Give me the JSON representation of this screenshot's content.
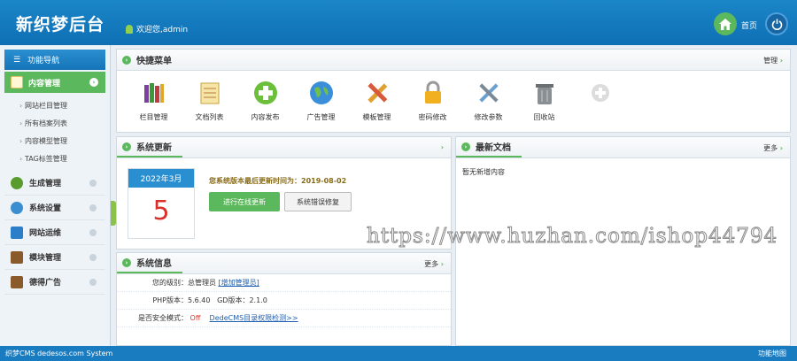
{
  "header": {
    "logo": "新织梦后台",
    "welcome": "欢迎您,admin",
    "home_label": "首页",
    "home_icon": "home-icon",
    "power_icon": "power-icon"
  },
  "sidebar": {
    "title": "功能导航",
    "active": "内容管理",
    "subitems": [
      "网站栏目管理",
      "所有档案列表",
      "内容模型管理",
      "TAG标签管理"
    ],
    "items": [
      {
        "label": "生成管理",
        "icon": "tree-icon"
      },
      {
        "label": "系统设置",
        "icon": "gears-icon"
      },
      {
        "label": "网站运维",
        "icon": "monitor-icon"
      },
      {
        "label": "模块管理",
        "icon": "book-icon"
      },
      {
        "label": "德得广告",
        "icon": "book-icon"
      }
    ]
  },
  "quick": {
    "title": "快捷菜单",
    "manage": "管理",
    "items": [
      {
        "label": "栏目管理",
        "icon": "books-icon"
      },
      {
        "label": "文档列表",
        "icon": "notepad-icon"
      },
      {
        "label": "内容发布",
        "icon": "plus-circle-icon"
      },
      {
        "label": "广告管理",
        "icon": "globe-icon"
      },
      {
        "label": "模板管理",
        "icon": "pencil-ruler-icon"
      },
      {
        "label": "密码修改",
        "icon": "lock-icon"
      },
      {
        "label": "修改参数",
        "icon": "tools-icon"
      },
      {
        "label": "回收站",
        "icon": "trash-icon"
      }
    ]
  },
  "update": {
    "title": "系统更新",
    "month": "2022年3月",
    "day": "5",
    "notice": "您系统版本最后更新时间为：2019-08-02",
    "btn_online": "进行在线更新",
    "btn_fix": "系统错误修复"
  },
  "latest": {
    "title": "最新文档",
    "more": "更多",
    "empty": "暂无新增内容"
  },
  "sysinfo": {
    "title": "系统信息",
    "more": "更多",
    "level_k": "您的级别：",
    "level_v": "总管理员",
    "add_admin": "[增加管理员]",
    "php_k": "PHP版本：",
    "php_v": "5.6.40",
    "gd": "GD版本：2.1.0",
    "safe_k": "是否安全模式：",
    "safe_v": "Off",
    "check_link": "DedeCMS目录权限检测>>"
  },
  "footer": {
    "left": "织梦CMS  dedesos.com System",
    "right": "功能地图"
  },
  "watermark": "https://www.huzhan.com/ishop44794",
  "colors": {
    "brand": "#1a7cc0",
    "accent": "#5cb85c",
    "alert": "#d9302c"
  }
}
